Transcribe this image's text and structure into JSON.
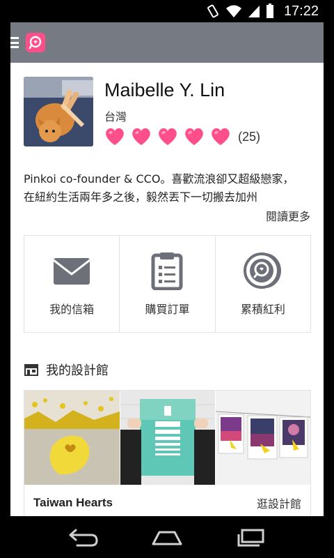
{
  "status_bar": {
    "time": "17:22",
    "icons": [
      "rotate-icon",
      "wifi-icon",
      "signal-icon",
      "battery-icon"
    ]
  },
  "app_bar": {
    "menu_icon": "hamburger-menu-icon",
    "logo_icon": "pinkoi-logo-icon",
    "brand_color": "#ff4f8b",
    "bar_color": "#767a82"
  },
  "profile": {
    "name": "Maibelle Y. Lin",
    "location": "台灣",
    "rating_hearts": 5,
    "rating_count": "(25)",
    "heart_color": "#ff4f8b"
  },
  "bio": {
    "line1": "Pinkoi co-founder & CCO。喜歡流浪卻又超級戀家，",
    "line2": "在紐約生活兩年多之後，毅然丟下一切搬去加州",
    "read_more": "閱讀更多"
  },
  "actions": [
    {
      "label": "我的信箱",
      "icon": "mail-icon"
    },
    {
      "label": "購買訂單",
      "icon": "clipboard-list-icon"
    },
    {
      "label": "累積紅利",
      "icon": "coin-icon"
    }
  ],
  "shop": {
    "section_title": "我的設計館",
    "section_icon": "shop-icon",
    "shop_name": "Taiwan Hearts",
    "visit_label": "逛設計館",
    "images": [
      "yellow-taiwan-heart-photo",
      "eye-chart-poster-photo",
      "hanging-prints-photo"
    ]
  },
  "nav_bar": {
    "icons": [
      "back-icon",
      "home-icon",
      "recents-icon"
    ]
  }
}
